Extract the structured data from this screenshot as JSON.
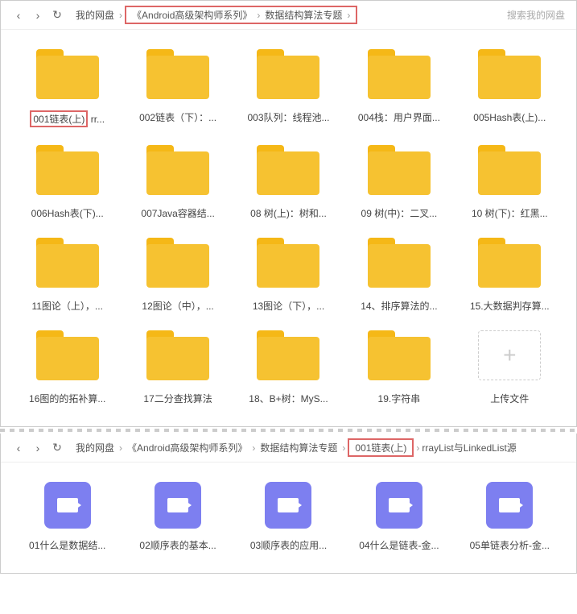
{
  "toolbar1": {
    "root": "我的网盘",
    "crumb1": "《Android高级架构师系列》",
    "crumb2": "数据结构算法专题",
    "search_placeholder": "搜索我的网盘"
  },
  "folders": [
    {
      "label": "001链表(上)",
      "suffix": " rr...",
      "highlighted": true
    },
    {
      "label": "002链表（下）：..."
    },
    {
      "label": "003队列：线程池..."
    },
    {
      "label": "004栈：用户界面..."
    },
    {
      "label": "005Hash表(上)..."
    },
    {
      "label": "006Hash表(下)..."
    },
    {
      "label": "007Java容器结..."
    },
    {
      "label": "08 树(上)：树和..."
    },
    {
      "label": "09 树(中)：二叉..."
    },
    {
      "label": "10 树(下)：红黑..."
    },
    {
      "label": "11图论（上），..."
    },
    {
      "label": "12图论（中），..."
    },
    {
      "label": "13图论（下），..."
    },
    {
      "label": "14、排序算法的..."
    },
    {
      "label": "15.大数据判存算..."
    },
    {
      "label": "16图的的拓补算..."
    },
    {
      "label": "17二分查找算法"
    },
    {
      "label": "18、B+树：MyS..."
    },
    {
      "label": "19.字符串"
    }
  ],
  "upload_label": "上传文件",
  "toolbar2": {
    "root": "我的网盘",
    "crumb1": "《Android高级架构师系列》",
    "crumb2": "数据结构算法专题",
    "crumb3": "001链表(上)",
    "trail": "rrayList与LinkedList源"
  },
  "videos": [
    {
      "label": "01什么是数据结..."
    },
    {
      "label": "02顺序表的基本..."
    },
    {
      "label": "03顺序表的应用..."
    },
    {
      "label": "04什么是链表-金..."
    },
    {
      "label": "05单链表分析-金..."
    }
  ]
}
